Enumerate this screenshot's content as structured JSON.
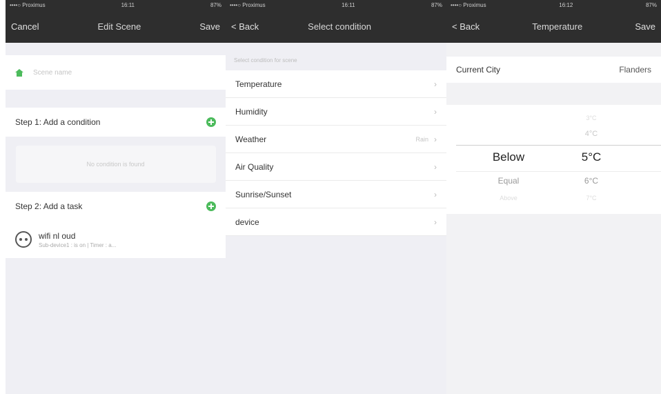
{
  "panel1": {
    "status": {
      "carrier": "••••○ Proximus",
      "time": "16:11",
      "battery": "87%"
    },
    "nav": {
      "left": "Cancel",
      "title": "Edit Scene",
      "right": "Save"
    },
    "scene_name_placeholder": "Scene name",
    "step1_label": "Step 1: Add a condition",
    "no_condition_text": "No condition is found",
    "step2_label": "Step 2: Add a task",
    "task": {
      "name": "wifi nl oud",
      "desc": "Sub-device1 : is on | Timer : a..."
    },
    "icons": {
      "scene": "home-icon",
      "add": "plus-circle-icon",
      "task": "smart-plug-icon"
    },
    "colors": {
      "nav_bg": "#2e2e2e",
      "accent": "#4cbb5c"
    }
  },
  "panel2": {
    "status": {
      "carrier": "••••○ Proximus",
      "time": "16:11",
      "battery": "87%"
    },
    "nav": {
      "left": "< Back",
      "title": "Select condition"
    },
    "section_header": "Select condition for scene",
    "conditions": [
      {
        "label": "Temperature",
        "value": ""
      },
      {
        "label": "Humidity",
        "value": ""
      },
      {
        "label": "Weather",
        "value": "Rain"
      },
      {
        "label": "Air Quality",
        "value": ""
      },
      {
        "label": "Sunrise/Sunset",
        "value": ""
      },
      {
        "label": "device",
        "value": ""
      }
    ]
  },
  "panel3": {
    "status": {
      "carrier": "••••○ Proximus",
      "time": "16:12",
      "battery": "87%"
    },
    "nav": {
      "left": "< Back",
      "title": "Temperature",
      "right": "Save"
    },
    "current_city_label": "Current City",
    "current_city_value": "Flanders",
    "picker": {
      "operators": {
        "selected": "Below",
        "next1": "Equal",
        "next2": "Above"
      },
      "temps": {
        "prev2": "3°C",
        "prev1": "4°C",
        "selected": "5°C",
        "next1": "6°C",
        "next2": "7°C"
      }
    }
  }
}
